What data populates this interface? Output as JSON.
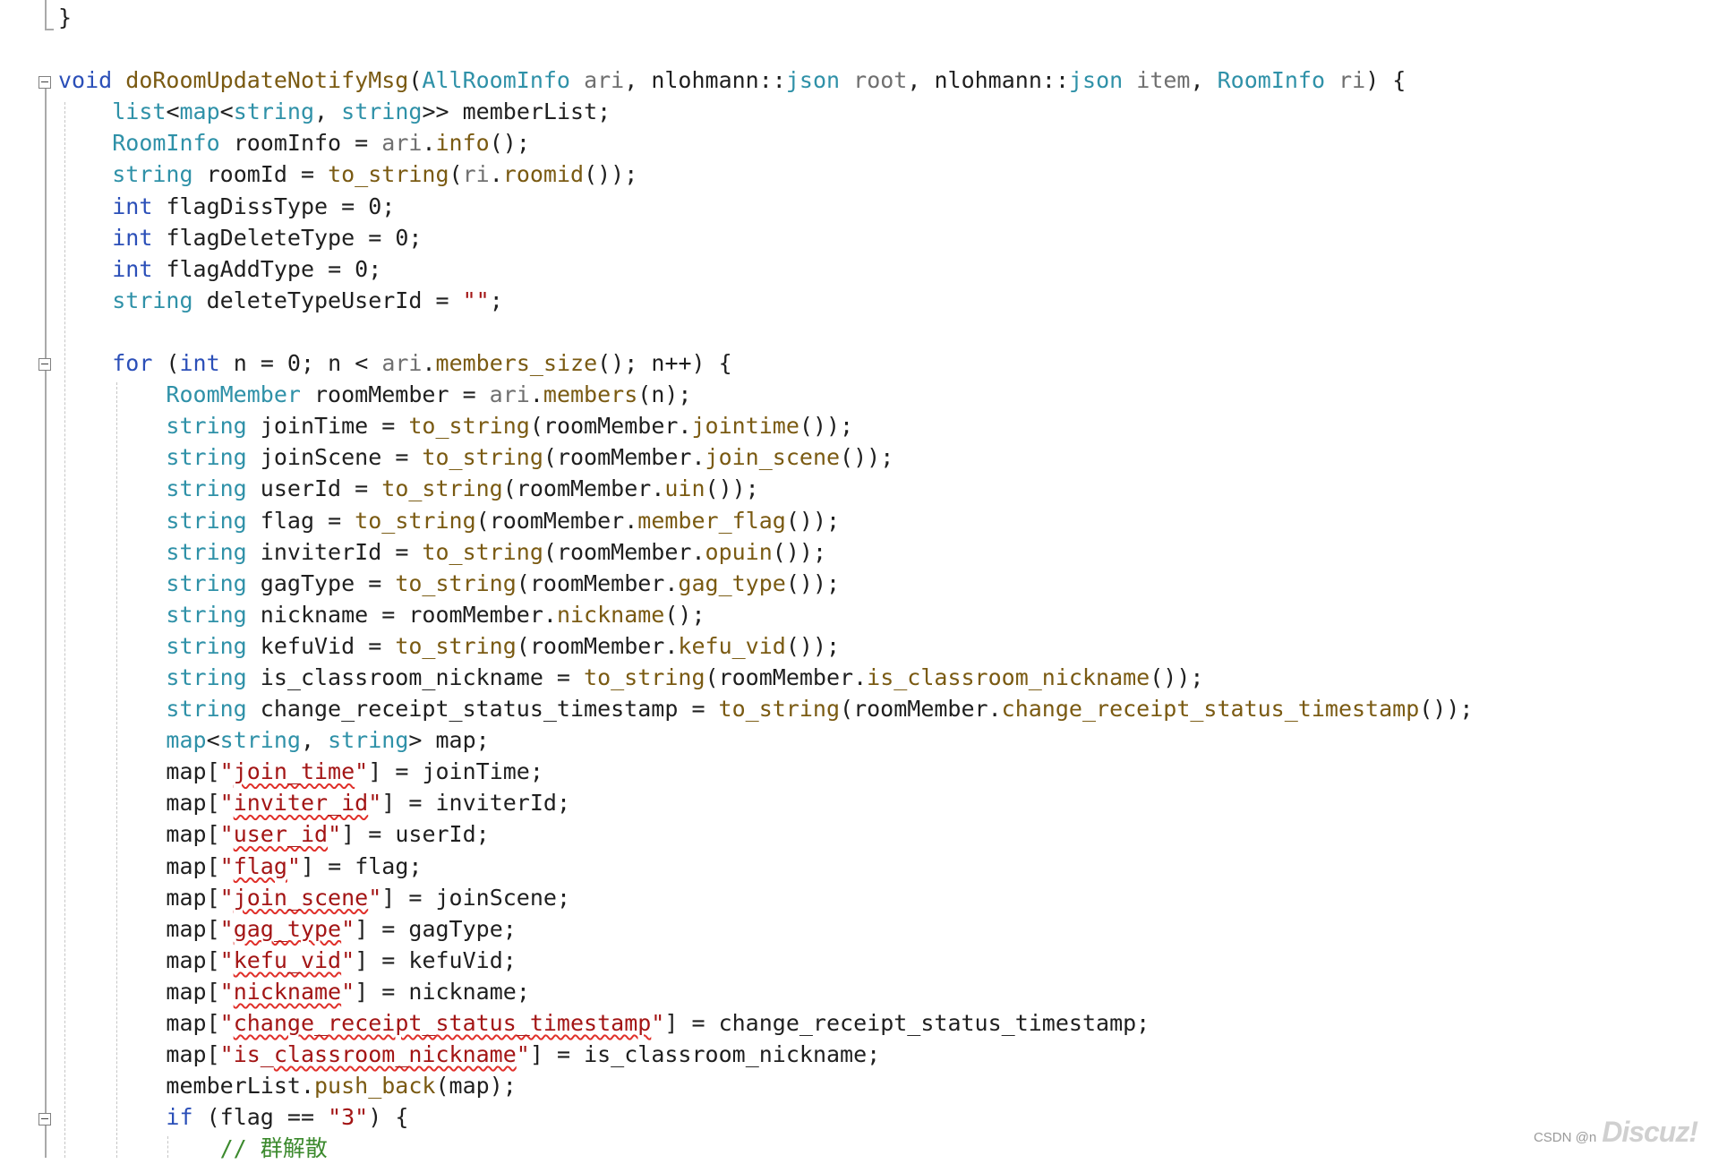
{
  "lines": [
    [
      [
        "}",
        "punct"
      ]
    ],
    [],
    [
      [
        "void",
        "kw"
      ],
      [
        " ",
        "var"
      ],
      [
        "doRoomUpdateNotifyMsg",
        "func"
      ],
      [
        "(",
        "punct"
      ],
      [
        "AllRoomInfo",
        "type"
      ],
      [
        " ",
        "var"
      ],
      [
        "ari",
        "param"
      ],
      [
        ", ",
        "punct"
      ],
      [
        "nlohmann",
        "ns"
      ],
      [
        "::",
        "punct"
      ],
      [
        "json",
        "type"
      ],
      [
        " ",
        "var"
      ],
      [
        "root",
        "param"
      ],
      [
        ", ",
        "punct"
      ],
      [
        "nlohmann",
        "ns"
      ],
      [
        "::",
        "punct"
      ],
      [
        "json",
        "type"
      ],
      [
        " ",
        "var"
      ],
      [
        "item",
        "param"
      ],
      [
        ", ",
        "punct"
      ],
      [
        "RoomInfo",
        "type"
      ],
      [
        " ",
        "var"
      ],
      [
        "ri",
        "param"
      ],
      [
        ") {",
        "punct"
      ]
    ],
    [
      [
        "    ",
        "var"
      ],
      [
        "list",
        "type"
      ],
      [
        "<",
        "punct"
      ],
      [
        "map",
        "type"
      ],
      [
        "<",
        "punct"
      ],
      [
        "string",
        "type"
      ],
      [
        ", ",
        "punct"
      ],
      [
        "string",
        "type"
      ],
      [
        ">> ",
        "punct"
      ],
      [
        "memberList",
        "var"
      ],
      [
        ";",
        "punct"
      ]
    ],
    [
      [
        "    ",
        "var"
      ],
      [
        "RoomInfo",
        "type"
      ],
      [
        " ",
        "var"
      ],
      [
        "roomInfo",
        "var"
      ],
      [
        " = ",
        "punct"
      ],
      [
        "ari",
        "param"
      ],
      [
        ".",
        "punct"
      ],
      [
        "info",
        "member"
      ],
      [
        "();",
        "punct"
      ]
    ],
    [
      [
        "    ",
        "var"
      ],
      [
        "string",
        "type"
      ],
      [
        " ",
        "var"
      ],
      [
        "roomId",
        "var"
      ],
      [
        " = ",
        "punct"
      ],
      [
        "to_string",
        "func"
      ],
      [
        "(",
        "punct"
      ],
      [
        "ri",
        "param"
      ],
      [
        ".",
        "punct"
      ],
      [
        "roomid",
        "member"
      ],
      [
        "());",
        "punct"
      ]
    ],
    [
      [
        "    ",
        "var"
      ],
      [
        "int",
        "kw"
      ],
      [
        " ",
        "var"
      ],
      [
        "flagDissType",
        "var"
      ],
      [
        " = ",
        "punct"
      ],
      [
        "0",
        "num"
      ],
      [
        ";",
        "punct"
      ]
    ],
    [
      [
        "    ",
        "var"
      ],
      [
        "int",
        "kw"
      ],
      [
        " ",
        "var"
      ],
      [
        "flagDeleteType",
        "var"
      ],
      [
        " = ",
        "punct"
      ],
      [
        "0",
        "num"
      ],
      [
        ";",
        "punct"
      ]
    ],
    [
      [
        "    ",
        "var"
      ],
      [
        "int",
        "kw"
      ],
      [
        " ",
        "var"
      ],
      [
        "flagAddType",
        "var"
      ],
      [
        " = ",
        "punct"
      ],
      [
        "0",
        "num"
      ],
      [
        ";",
        "punct"
      ]
    ],
    [
      [
        "    ",
        "var"
      ],
      [
        "string",
        "type"
      ],
      [
        " ",
        "var"
      ],
      [
        "deleteTypeUserId",
        "var"
      ],
      [
        " = ",
        "punct"
      ],
      [
        "\"\"",
        "str"
      ],
      [
        ";",
        "punct"
      ]
    ],
    [],
    [
      [
        "    ",
        "var"
      ],
      [
        "for",
        "kw"
      ],
      [
        " (",
        "punct"
      ],
      [
        "int",
        "kw"
      ],
      [
        " ",
        "var"
      ],
      [
        "n",
        "var"
      ],
      [
        " = ",
        "punct"
      ],
      [
        "0",
        "num"
      ],
      [
        "; ",
        "punct"
      ],
      [
        "n",
        "var"
      ],
      [
        " < ",
        "punct"
      ],
      [
        "ari",
        "param"
      ],
      [
        ".",
        "punct"
      ],
      [
        "members_size",
        "member"
      ],
      [
        "(); ",
        "punct"
      ],
      [
        "n",
        "var"
      ],
      [
        "++) {",
        "punct"
      ]
    ],
    [
      [
        "        ",
        "var"
      ],
      [
        "RoomMember",
        "type"
      ],
      [
        " ",
        "var"
      ],
      [
        "roomMember",
        "var"
      ],
      [
        " = ",
        "punct"
      ],
      [
        "ari",
        "param"
      ],
      [
        ".",
        "punct"
      ],
      [
        "members",
        "member"
      ],
      [
        "(",
        "punct"
      ],
      [
        "n",
        "var"
      ],
      [
        ");",
        "punct"
      ]
    ],
    [
      [
        "        ",
        "var"
      ],
      [
        "string",
        "type"
      ],
      [
        " ",
        "var"
      ],
      [
        "joinTime",
        "var"
      ],
      [
        " = ",
        "punct"
      ],
      [
        "to_string",
        "func"
      ],
      [
        "(",
        "punct"
      ],
      [
        "roomMember",
        "var"
      ],
      [
        ".",
        "punct"
      ],
      [
        "jointime",
        "member"
      ],
      [
        "());",
        "punct"
      ]
    ],
    [
      [
        "        ",
        "var"
      ],
      [
        "string",
        "type"
      ],
      [
        " ",
        "var"
      ],
      [
        "joinScene",
        "var"
      ],
      [
        " = ",
        "punct"
      ],
      [
        "to_string",
        "func"
      ],
      [
        "(",
        "punct"
      ],
      [
        "roomMember",
        "var"
      ],
      [
        ".",
        "punct"
      ],
      [
        "join_scene",
        "member"
      ],
      [
        "());",
        "punct"
      ]
    ],
    [
      [
        "        ",
        "var"
      ],
      [
        "string",
        "type"
      ],
      [
        " ",
        "var"
      ],
      [
        "userId",
        "var"
      ],
      [
        " = ",
        "punct"
      ],
      [
        "to_string",
        "func"
      ],
      [
        "(",
        "punct"
      ],
      [
        "roomMember",
        "var"
      ],
      [
        ".",
        "punct"
      ],
      [
        "uin",
        "member"
      ],
      [
        "());",
        "punct"
      ]
    ],
    [
      [
        "        ",
        "var"
      ],
      [
        "string",
        "type"
      ],
      [
        " ",
        "var"
      ],
      [
        "flag",
        "var"
      ],
      [
        " = ",
        "punct"
      ],
      [
        "to_string",
        "func"
      ],
      [
        "(",
        "punct"
      ],
      [
        "roomMember",
        "var"
      ],
      [
        ".",
        "punct"
      ],
      [
        "member_flag",
        "member"
      ],
      [
        "());",
        "punct"
      ]
    ],
    [
      [
        "        ",
        "var"
      ],
      [
        "string",
        "type"
      ],
      [
        " ",
        "var"
      ],
      [
        "inviterId",
        "var"
      ],
      [
        " = ",
        "punct"
      ],
      [
        "to_string",
        "func"
      ],
      [
        "(",
        "punct"
      ],
      [
        "roomMember",
        "var"
      ],
      [
        ".",
        "punct"
      ],
      [
        "opuin",
        "member"
      ],
      [
        "());",
        "punct"
      ]
    ],
    [
      [
        "        ",
        "var"
      ],
      [
        "string",
        "type"
      ],
      [
        " ",
        "var"
      ],
      [
        "gagType",
        "var"
      ],
      [
        " = ",
        "punct"
      ],
      [
        "to_string",
        "func"
      ],
      [
        "(",
        "punct"
      ],
      [
        "roomMember",
        "var"
      ],
      [
        ".",
        "punct"
      ],
      [
        "gag_type",
        "member"
      ],
      [
        "());",
        "punct"
      ]
    ],
    [
      [
        "        ",
        "var"
      ],
      [
        "string",
        "type"
      ],
      [
        " ",
        "var"
      ],
      [
        "nickname",
        "var"
      ],
      [
        " = ",
        "punct"
      ],
      [
        "roomMember",
        "var"
      ],
      [
        ".",
        "punct"
      ],
      [
        "nickname",
        "member"
      ],
      [
        "();",
        "punct"
      ]
    ],
    [
      [
        "        ",
        "var"
      ],
      [
        "string",
        "type"
      ],
      [
        " ",
        "var"
      ],
      [
        "kefuVid",
        "var"
      ],
      [
        " = ",
        "punct"
      ],
      [
        "to_string",
        "func"
      ],
      [
        "(",
        "punct"
      ],
      [
        "roomMember",
        "var"
      ],
      [
        ".",
        "punct"
      ],
      [
        "kefu_vid",
        "member"
      ],
      [
        "());",
        "punct"
      ]
    ],
    [
      [
        "        ",
        "var"
      ],
      [
        "string",
        "type"
      ],
      [
        " ",
        "var"
      ],
      [
        "is_classroom_nickname",
        "var"
      ],
      [
        " = ",
        "punct"
      ],
      [
        "to_string",
        "func"
      ],
      [
        "(",
        "punct"
      ],
      [
        "roomMember",
        "var"
      ],
      [
        ".",
        "punct"
      ],
      [
        "is_classroom_nickname",
        "member"
      ],
      [
        "());",
        "punct"
      ]
    ],
    [
      [
        "        ",
        "var"
      ],
      [
        "string",
        "type"
      ],
      [
        " ",
        "var"
      ],
      [
        "change_receipt_status_timestamp",
        "var"
      ],
      [
        " = ",
        "punct"
      ],
      [
        "to_string",
        "func"
      ],
      [
        "(",
        "punct"
      ],
      [
        "roomMember",
        "var"
      ],
      [
        ".",
        "punct"
      ],
      [
        "change_receipt_status_timestamp",
        "member"
      ],
      [
        "());",
        "punct"
      ]
    ],
    [
      [
        "        ",
        "var"
      ],
      [
        "map",
        "type"
      ],
      [
        "<",
        "punct"
      ],
      [
        "string",
        "type"
      ],
      [
        ", ",
        "punct"
      ],
      [
        "string",
        "type"
      ],
      [
        "> ",
        "punct"
      ],
      [
        "map",
        "var"
      ],
      [
        ";",
        "punct"
      ]
    ],
    [
      [
        "        ",
        "var"
      ],
      [
        "map",
        "var"
      ],
      [
        "[",
        "punct"
      ],
      [
        "\"",
        "str"
      ],
      [
        "join_time",
        "strsq"
      ],
      [
        "\"",
        "str"
      ],
      [
        "] = ",
        "punct"
      ],
      [
        "joinTime",
        "var"
      ],
      [
        ";",
        "punct"
      ]
    ],
    [
      [
        "        ",
        "var"
      ],
      [
        "map",
        "var"
      ],
      [
        "[",
        "punct"
      ],
      [
        "\"",
        "str"
      ],
      [
        "inviter_id",
        "strsq"
      ],
      [
        "\"",
        "str"
      ],
      [
        "] = ",
        "punct"
      ],
      [
        "inviterId",
        "var"
      ],
      [
        ";",
        "punct"
      ]
    ],
    [
      [
        "        ",
        "var"
      ],
      [
        "map",
        "var"
      ],
      [
        "[",
        "punct"
      ],
      [
        "\"",
        "str"
      ],
      [
        "user_id",
        "strsq"
      ],
      [
        "\"",
        "str"
      ],
      [
        "] = ",
        "punct"
      ],
      [
        "userId",
        "var"
      ],
      [
        ";",
        "punct"
      ]
    ],
    [
      [
        "        ",
        "var"
      ],
      [
        "map",
        "var"
      ],
      [
        "[",
        "punct"
      ],
      [
        "\"",
        "str"
      ],
      [
        "flag",
        "strsq"
      ],
      [
        "\"",
        "str"
      ],
      [
        "] = ",
        "punct"
      ],
      [
        "flag",
        "var"
      ],
      [
        ";",
        "punct"
      ]
    ],
    [
      [
        "        ",
        "var"
      ],
      [
        "map",
        "var"
      ],
      [
        "[",
        "punct"
      ],
      [
        "\"",
        "str"
      ],
      [
        "join_scene",
        "strsq"
      ],
      [
        "\"",
        "str"
      ],
      [
        "] = ",
        "punct"
      ],
      [
        "joinScene",
        "var"
      ],
      [
        ";",
        "punct"
      ]
    ],
    [
      [
        "        ",
        "var"
      ],
      [
        "map",
        "var"
      ],
      [
        "[",
        "punct"
      ],
      [
        "\"",
        "str"
      ],
      [
        "gag_type",
        "strsq"
      ],
      [
        "\"",
        "str"
      ],
      [
        "] = ",
        "punct"
      ],
      [
        "gagType",
        "var"
      ],
      [
        ";",
        "punct"
      ]
    ],
    [
      [
        "        ",
        "var"
      ],
      [
        "map",
        "var"
      ],
      [
        "[",
        "punct"
      ],
      [
        "\"",
        "str"
      ],
      [
        "kefu_vid",
        "strsq"
      ],
      [
        "\"",
        "str"
      ],
      [
        "] = ",
        "punct"
      ],
      [
        "kefuVid",
        "var"
      ],
      [
        ";",
        "punct"
      ]
    ],
    [
      [
        "        ",
        "var"
      ],
      [
        "map",
        "var"
      ],
      [
        "[",
        "punct"
      ],
      [
        "\"",
        "str"
      ],
      [
        "nickname",
        "strsq"
      ],
      [
        "\"",
        "str"
      ],
      [
        "] = ",
        "punct"
      ],
      [
        "nickname",
        "var"
      ],
      [
        ";",
        "punct"
      ]
    ],
    [
      [
        "        ",
        "var"
      ],
      [
        "map",
        "var"
      ],
      [
        "[",
        "punct"
      ],
      [
        "\"",
        "str"
      ],
      [
        "change_receipt_status_timestamp",
        "strsq"
      ],
      [
        "\"",
        "str"
      ],
      [
        "] = ",
        "punct"
      ],
      [
        "change_receipt_status_timestamp",
        "var"
      ],
      [
        ";",
        "punct"
      ]
    ],
    [
      [
        "        ",
        "var"
      ],
      [
        "map",
        "var"
      ],
      [
        "[",
        "punct"
      ],
      [
        "\"is_",
        "str"
      ],
      [
        "classroom_nickname",
        "strsq"
      ],
      [
        "\"",
        "str"
      ],
      [
        "] = ",
        "punct"
      ],
      [
        "is_classroom_nickname",
        "var"
      ],
      [
        ";",
        "punct"
      ]
    ],
    [
      [
        "        ",
        "var"
      ],
      [
        "memberList",
        "var"
      ],
      [
        ".",
        "punct"
      ],
      [
        "push_back",
        "member"
      ],
      [
        "(",
        "punct"
      ],
      [
        "map",
        "var"
      ],
      [
        ");",
        "punct"
      ]
    ],
    [
      [
        "        ",
        "var"
      ],
      [
        "if",
        "kw"
      ],
      [
        " (",
        "punct"
      ],
      [
        "flag",
        "var"
      ],
      [
        " == ",
        "punct"
      ],
      [
        "\"3\"",
        "str"
      ],
      [
        ") {",
        "punct"
      ]
    ],
    [
      [
        "            ",
        "var"
      ],
      [
        "// 群解散",
        "comment"
      ]
    ]
  ],
  "folds": [
    2,
    11,
    35
  ],
  "watermark": {
    "csdn": "CSDN @n",
    "logo": "Discuz!"
  }
}
